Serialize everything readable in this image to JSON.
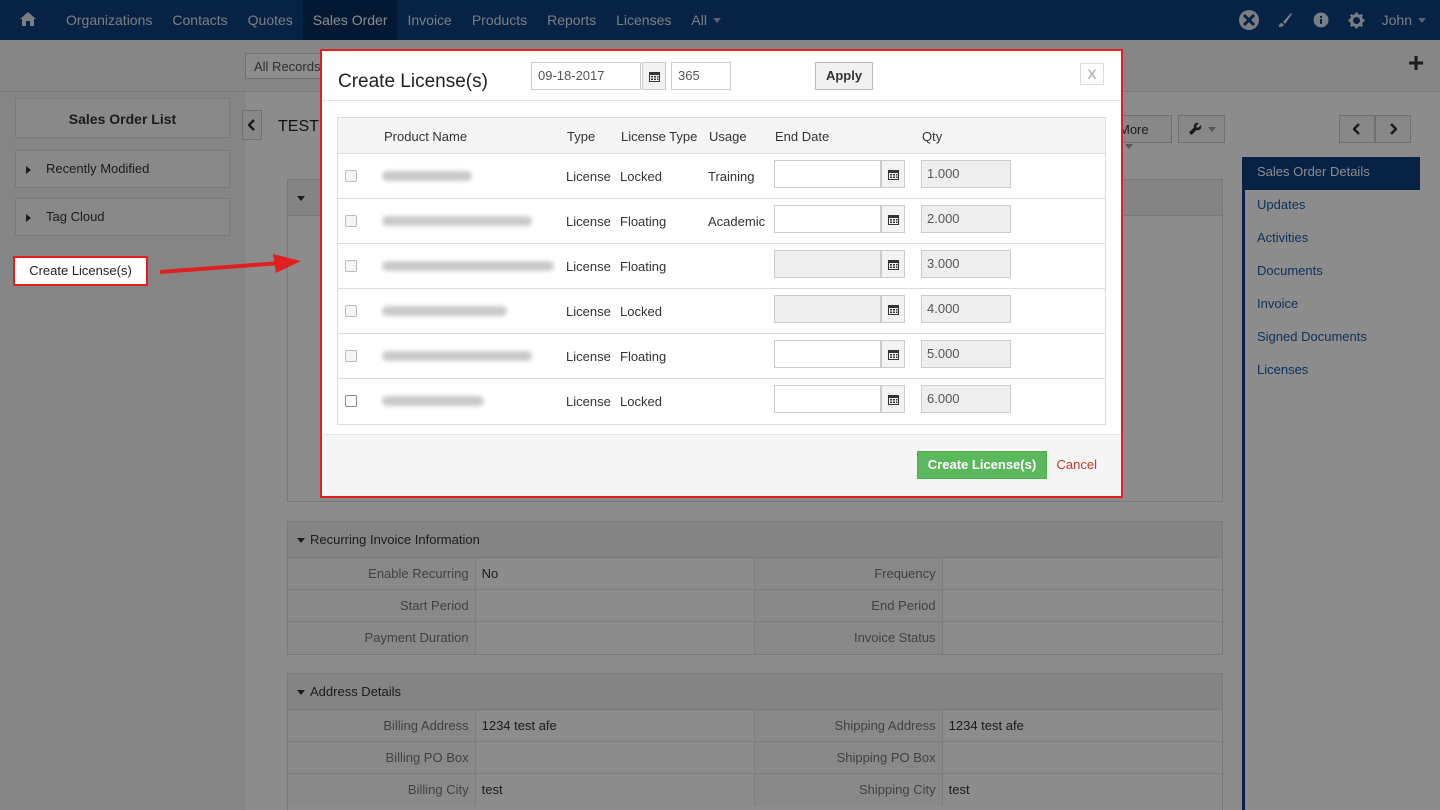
{
  "nav": {
    "items": [
      "Organizations",
      "Contacts",
      "Quotes",
      "Sales Order",
      "Invoice",
      "Products",
      "Reports",
      "Licenses",
      "All"
    ],
    "active": "Sales Order",
    "user": "John"
  },
  "subbar": {
    "records_label": "All Records"
  },
  "left": {
    "title": "Sales Order List",
    "items": [
      "Recently Modified",
      "Tag Cloud"
    ],
    "annotation": "Create License(s)"
  },
  "main": {
    "record_title": "TEST1",
    "more_label": "More",
    "blocks": {
      "recurring": {
        "title": "Recurring Invoice Information",
        "rows": [
          [
            "Enable Recurring",
            "No",
            "Frequency",
            ""
          ],
          [
            "Start Period",
            "",
            "End Period",
            ""
          ],
          [
            "Payment Duration",
            "",
            "Invoice Status",
            ""
          ]
        ]
      },
      "address": {
        "title": "Address Details",
        "rows": [
          [
            "Billing Address",
            "1234 test afe",
            "Shipping Address",
            "1234 test afe"
          ],
          [
            "Billing PO Box",
            "",
            "Shipping PO Box",
            ""
          ],
          [
            "Billing City",
            "test",
            "Shipping City",
            "test"
          ]
        ]
      }
    }
  },
  "right_panel": {
    "items": [
      "Sales Order Details",
      "Updates",
      "Activities",
      "Documents",
      "Invoice",
      "Signed Documents",
      "Licenses"
    ],
    "active": "Sales Order Details"
  },
  "modal": {
    "title": "Create License(s)",
    "date_value": "09-18-2017",
    "days_value": "365",
    "apply_label": "Apply",
    "close_label": "X",
    "columns": [
      "Product Name",
      "Type",
      "License Type",
      "Usage",
      "End Date",
      "Qty"
    ],
    "rows": [
      {
        "type": "License",
        "license_type": "Locked",
        "usage": "Training",
        "qty": "1.000",
        "end_enabled": true
      },
      {
        "type": "License",
        "license_type": "Floating",
        "usage": "Academic",
        "qty": "2.000",
        "end_enabled": true
      },
      {
        "type": "License",
        "license_type": "Floating",
        "usage": "",
        "qty": "3.000",
        "end_enabled": false
      },
      {
        "type": "License",
        "license_type": "Locked",
        "usage": "",
        "qty": "4.000",
        "end_enabled": false
      },
      {
        "type": "License",
        "license_type": "Floating",
        "usage": "",
        "qty": "5.000",
        "end_enabled": true
      },
      {
        "type": "License",
        "license_type": "Locked",
        "usage": "",
        "qty": "6.000",
        "end_enabled": true
      }
    ],
    "create_label": "Create License(s)",
    "cancel_label": "Cancel"
  },
  "colors": {
    "nav_bg": "#0b3f7e",
    "accent_red": "#e02020",
    "success_green": "#5cb85c",
    "link_blue": "#1a5ca8"
  }
}
